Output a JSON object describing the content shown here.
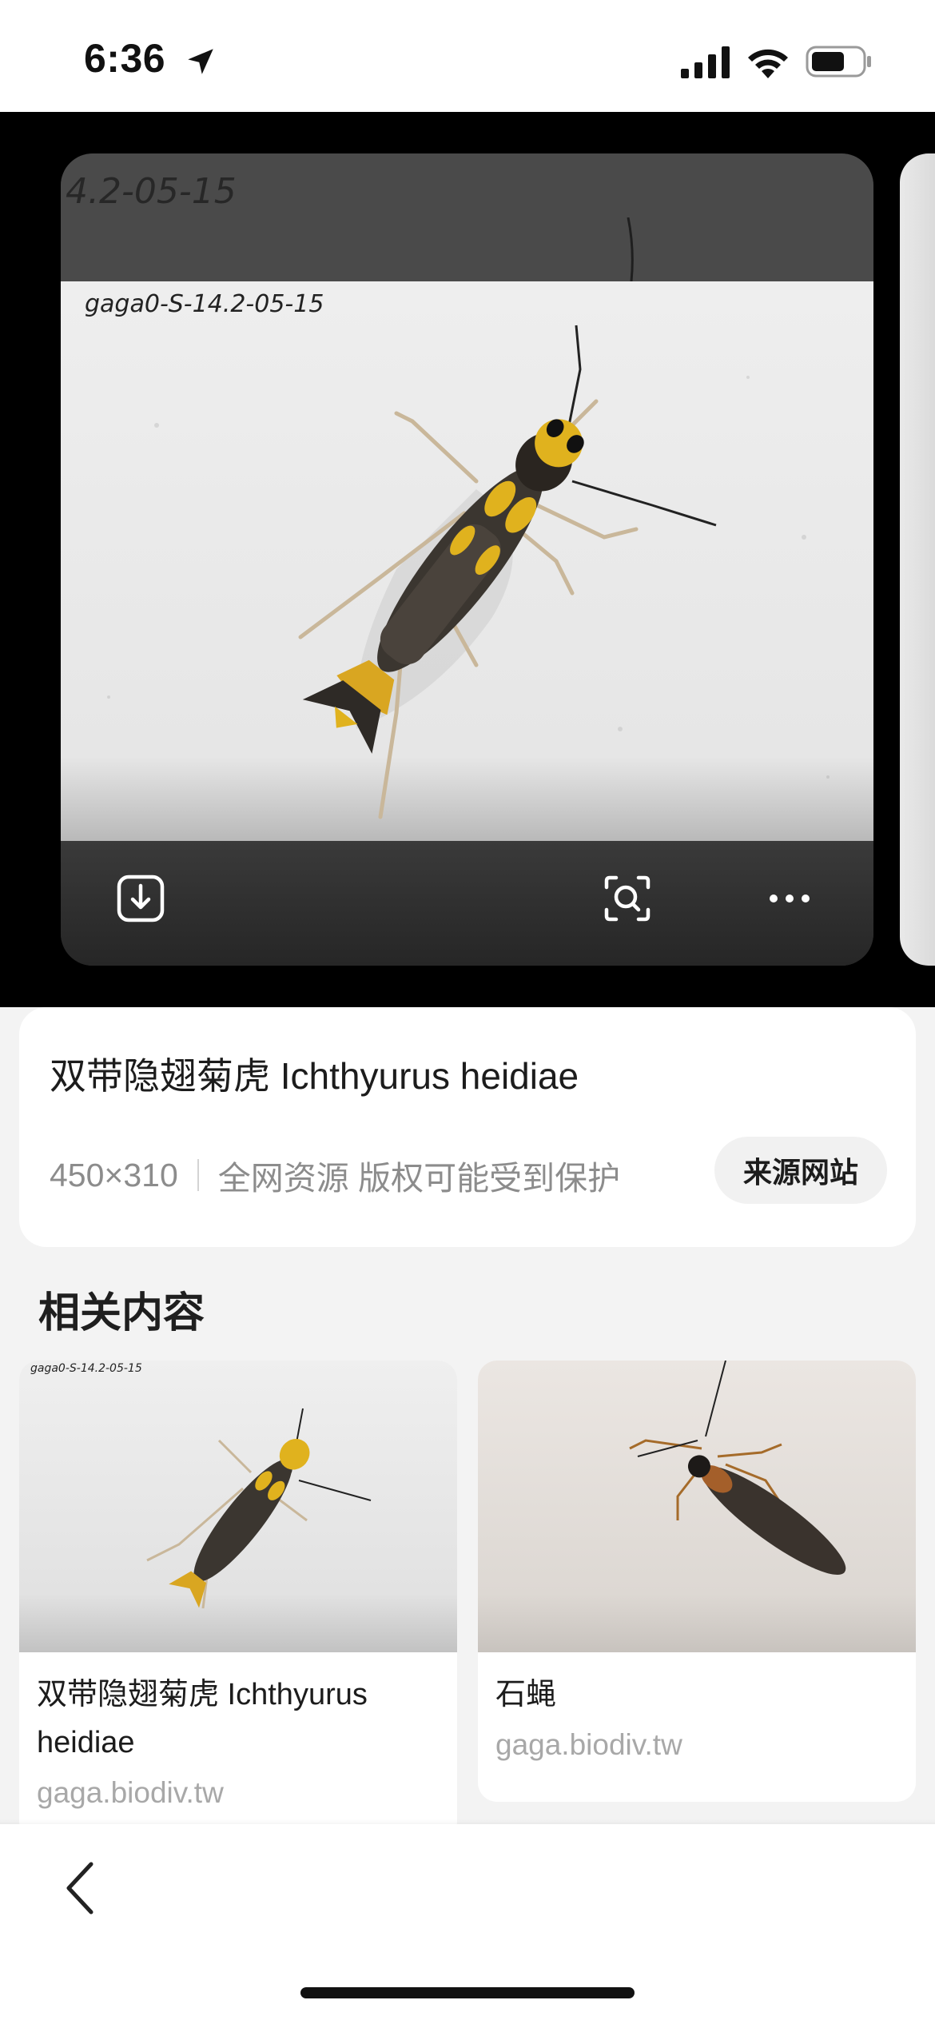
{
  "status_bar": {
    "time": "6:36",
    "icons": [
      "location-arrow-icon",
      "cellular-signal-icon",
      "wifi-icon",
      "battery-icon"
    ]
  },
  "viewer": {
    "ghost_label": "4.2-05-15",
    "photo_specimen_label": "gaga0-S-14.2-05-15",
    "toolbar_icons": [
      "download-icon",
      "visual-search-icon",
      "more-icon"
    ]
  },
  "info": {
    "title": "双带隐翅菊虎 Ichthyurus heidiae",
    "dimensions": "450×310",
    "meta": "全网资源 版权可能受到保护",
    "source_button": "来源网站"
  },
  "related": {
    "heading": "相关内容",
    "items": [
      {
        "title": "双带隐翅菊虎 Ichthyurus heidiae",
        "source": "gaga.biodiv.tw",
        "thumb_label": "gaga0-S-14.2-05-15"
      },
      {
        "title": "石蝇",
        "source": "gaga.biodiv.tw"
      }
    ]
  },
  "colors": {
    "viewer_bg": "#000000",
    "page_bg": "#f3f3f3",
    "card_bg": "#ffffff",
    "source_text": "#a8a8a8"
  }
}
